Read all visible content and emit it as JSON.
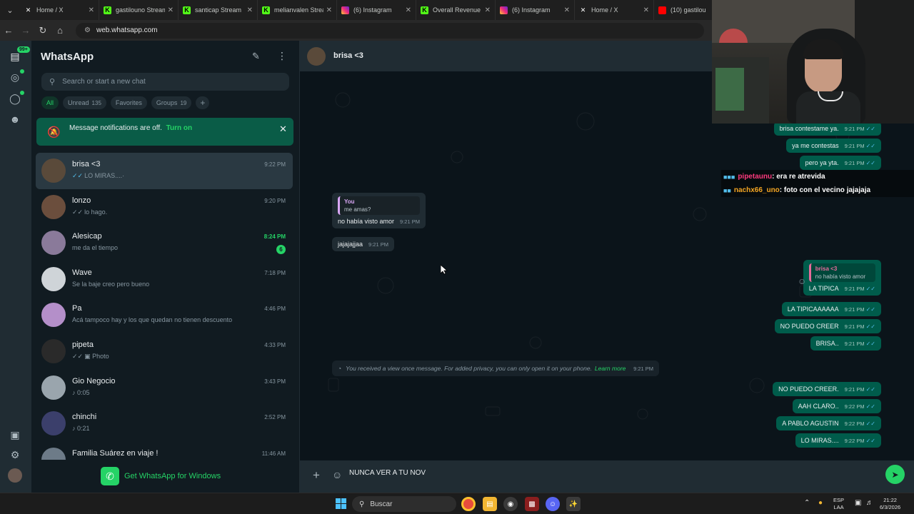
{
  "browser": {
    "tabs": [
      {
        "title": "Home / X",
        "icon": "x-logo-icon"
      },
      {
        "title": "gastilouno Stream",
        "icon": "kick-logo-icon"
      },
      {
        "title": "santicap Stream",
        "icon": "kick-logo-icon"
      },
      {
        "title": "melianvalen Strea",
        "icon": "kick-logo-icon"
      },
      {
        "title": "(6) Instagram",
        "icon": "instagram-icon"
      },
      {
        "title": "Overall Revenue",
        "icon": "kick-logo-icon"
      },
      {
        "title": "(6) Instagram",
        "icon": "instagram-icon"
      },
      {
        "title": "Home / X",
        "icon": "x-logo-icon"
      },
      {
        "title": "(10) gastilou",
        "icon": "youtube-icon"
      }
    ],
    "url": "web.whatsapp.com"
  },
  "rail": {
    "unread_badge": "99+"
  },
  "sidebar": {
    "title": "WhatsApp",
    "search_placeholder": "Search or start a new chat",
    "filters": {
      "all": "All",
      "unread": "Unread",
      "unread_count": "135",
      "favorites": "Favorites",
      "groups": "Groups",
      "groups_count": "19",
      "add": "+"
    },
    "notification": {
      "text": "Message notifications are off.",
      "action": "Turn on"
    },
    "chats": [
      {
        "name": "brisa <3",
        "time": "9:22 PM",
        "preview": "LO MIRAS....·",
        "tick": "blue",
        "selected": true,
        "avatar_color": "#5a4a3a"
      },
      {
        "name": "lonzo",
        "time": "9:20 PM",
        "preview": "lo hago.",
        "tick": "grey",
        "avatar_color": "#6b4e3d"
      },
      {
        "name": "Alesicap",
        "time": "8:24 PM",
        "preview": "me da el tiempo",
        "unread": "6",
        "avatar_color": "#8a7a9a"
      },
      {
        "name": "Wave",
        "time": "7:18 PM",
        "preview": "Se la baje creo pero bueno",
        "avatar_color": "#cfd4d8"
      },
      {
        "name": "Pa",
        "time": "4:46 PM",
        "preview": "Acá tampoco hay  y los que quedan no tienen descuento",
        "avatar_color": "#b48fc9"
      },
      {
        "name": "pipeta",
        "time": "4:33 PM",
        "preview": "Photo",
        "tick": "grey",
        "media": "photo-icon",
        "avatar_color": "#2a2a2a"
      },
      {
        "name": "Gio Negocio",
        "time": "3:43 PM",
        "preview": "0:05",
        "media": "mic-icon",
        "avatar_color": "#9aa5ad"
      },
      {
        "name": "chinchi",
        "time": "2:52 PM",
        "preview": "0:21",
        "media": "mic-icon",
        "avatar_color": "#3b3f6b"
      },
      {
        "name": "Familia Suárez en viaje !",
        "time": "11:46 AM",
        "preview": "",
        "avatar_color": "#6d7b88"
      }
    ],
    "get_app": "Get WhatsApp for Windows"
  },
  "conversation": {
    "contact_name": "brisa <3",
    "messages": [
      {
        "side": "out",
        "text": "brisa contestame ya.",
        "time": "9:21 PM"
      },
      {
        "side": "out",
        "text": "ya me contestas",
        "time": "9:21 PM"
      },
      {
        "side": "out",
        "text": "pero ya yta.",
        "time": "9:21 PM"
      },
      {
        "side": "in",
        "quote_name": "You",
        "quote_text": "me amas?",
        "text": "no había visto amor",
        "time": "9:21 PM"
      },
      {
        "side": "in",
        "text": "jajajajjaa",
        "time": "9:21 PM"
      },
      {
        "side": "out",
        "quote_name": "brisa <3",
        "quote_text": "no había visto amor",
        "text": "LA TIPICA",
        "time": "9:21 PM"
      },
      {
        "side": "out",
        "text": "LA TIPICAAAAAA",
        "time": "9:21 PM"
      },
      {
        "side": "out",
        "text": "NO PUEDO CREER",
        "time": "9:21 PM"
      },
      {
        "side": "out",
        "text": "BRISA..",
        "time": "9:21 PM"
      },
      {
        "side": "system",
        "text": "You received a view once message. For added privacy, you can only open it on your phone.",
        "link": "Learn more",
        "time": "9:21 PM"
      },
      {
        "side": "out",
        "text": "NO PUEDO CREER.",
        "time": "9:21 PM"
      },
      {
        "side": "out",
        "text": "AAH CLARO..",
        "time": "9:22 PM"
      },
      {
        "side": "out",
        "text": "A PABLO AGUSTIN",
        "time": "9:22 PM"
      },
      {
        "side": "out",
        "text": "LO MIRAS....",
        "time": "9:22 PM"
      }
    ],
    "compose_text": "NUNCA VER A TU NOV"
  },
  "stream_chat": [
    {
      "user": "pipetaunu",
      "text": ": era re atrevida"
    },
    {
      "user": "nachx66_uno",
      "text": ": foto con el vecino jajajaja"
    }
  ],
  "taskbar": {
    "search": "Buscar",
    "lang": [
      "ESP",
      "LAA"
    ],
    "time": "21:22",
    "date": "6/3/2026"
  }
}
